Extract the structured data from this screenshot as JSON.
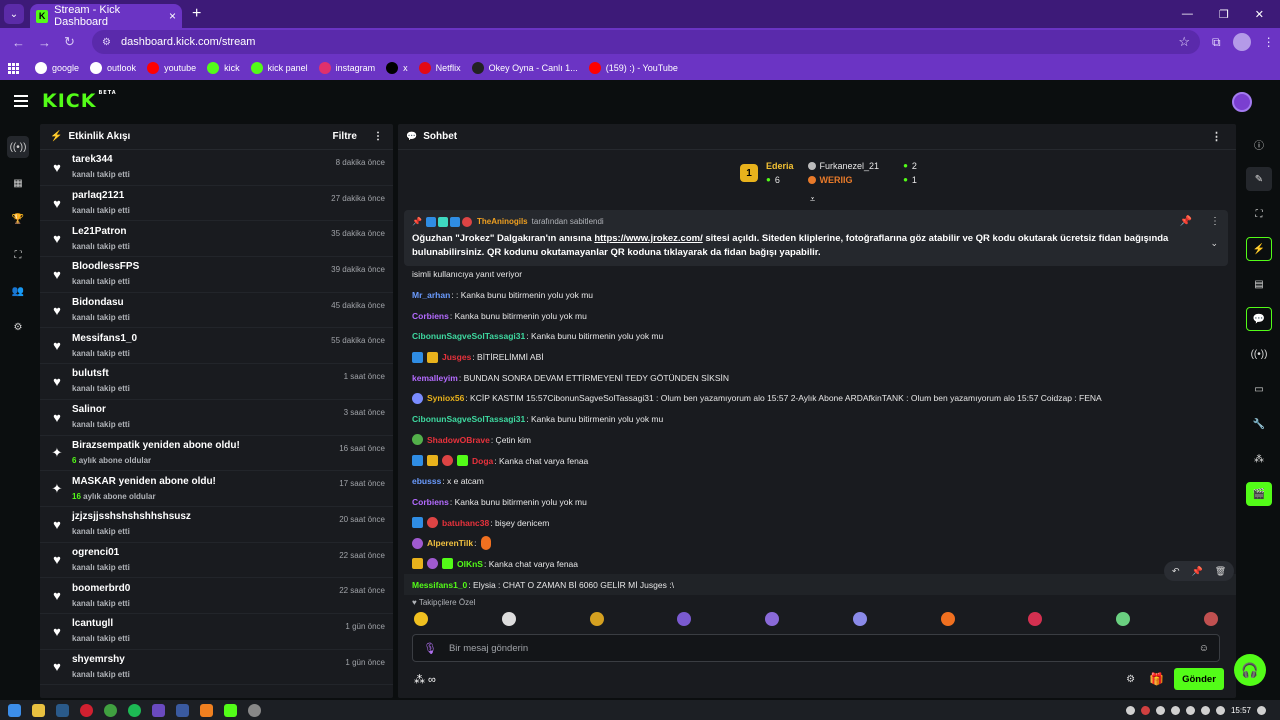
{
  "browser": {
    "tab_title": "Stream - Kick Dashboard",
    "tab_close": "×",
    "new_tab": "+",
    "url": "dashboard.kick.com/stream",
    "bookmarks": [
      {
        "label": "google",
        "color": "#ffffff"
      },
      {
        "label": "outlook",
        "color": "#ffffff"
      },
      {
        "label": "youtube",
        "color": "#ff0000"
      },
      {
        "label": "kick",
        "color": "#53fc18"
      },
      {
        "label": "kick panel",
        "color": "#53fc18"
      },
      {
        "label": "instagram",
        "color": "#e1306c"
      },
      {
        "label": "x",
        "color": "#000000"
      },
      {
        "label": "Netflix",
        "color": "#e50914"
      },
      {
        "label": "Okey Oyna - Canlı 1...",
        "color": "#222222"
      },
      {
        "label": "(159) :) - YouTube",
        "color": "#ff0000"
      }
    ]
  },
  "app": {
    "logo": "KICK",
    "beta": "BETA",
    "accent": "#53fc18"
  },
  "feed": {
    "title": "Etkinlik Akışı",
    "filter_label": "Filtre",
    "items": [
      {
        "name": "tarek344",
        "sub": "kanalı takip etti",
        "time": "8 dakika önce",
        "icon": "heart-icon"
      },
      {
        "name": "parlaq2121",
        "sub": "kanalı takip etti",
        "time": "27 dakika önce",
        "icon": "heart-icon"
      },
      {
        "name": "Le21Patron",
        "sub": "kanalı takip etti",
        "time": "35 dakika önce",
        "icon": "heart-icon"
      },
      {
        "name": "BloodlessFPS",
        "sub": "kanalı takip etti",
        "time": "39 dakika önce",
        "icon": "heart-icon"
      },
      {
        "name": "Bidondasu",
        "sub": "kanalı takip etti",
        "time": "45 dakika önce",
        "icon": "heart-icon"
      },
      {
        "name": "Messifans1_0",
        "sub": "kanalı takip etti",
        "time": "55 dakika önce",
        "icon": "heart-icon"
      },
      {
        "name": "bulutsft",
        "sub": "kanalı takip etti",
        "time": "1 saat önce",
        "icon": "heart-icon"
      },
      {
        "name": "Salinor",
        "sub": "kanalı takip etti",
        "time": "3 saat önce",
        "icon": "heart-icon"
      },
      {
        "name": "Birazsempatik yeniden abone oldu!",
        "sub_num": "6",
        "sub": "aylık abone oldular",
        "time": "16 saat önce",
        "icon": "sparkle-icon"
      },
      {
        "name": "MASKAR yeniden abone oldu!",
        "sub_num": "16",
        "sub": "aylık abone oldular",
        "time": "17 saat önce",
        "icon": "sparkle-icon"
      },
      {
        "name": "jzjzsjjsshshshshhshsusz",
        "sub": "kanalı takip etti",
        "time": "20 saat önce",
        "icon": "heart-icon"
      },
      {
        "name": "ogrenci01",
        "sub": "kanalı takip etti",
        "time": "22 saat önce",
        "icon": "heart-icon"
      },
      {
        "name": "boomerbrd0",
        "sub": "kanalı takip etti",
        "time": "22 saat önce",
        "icon": "heart-icon"
      },
      {
        "name": "lcantugll",
        "sub": "kanalı takip etti",
        "time": "1 gün önce",
        "icon": "heart-icon"
      },
      {
        "name": "shyemrshy",
        "sub": "kanalı takip etti",
        "time": "1 gün önce",
        "icon": "heart-icon"
      }
    ]
  },
  "chat": {
    "title": "Sohbet",
    "leaderboard": {
      "rank": "1",
      "first_name": "Ederia",
      "first_count": "6",
      "second_name": "Furkanezel_21",
      "second_count": "2",
      "third_name": "WERIIG",
      "third_count": "1"
    },
    "pinned": {
      "user": "TheAninogils",
      "pinned_by": "tarafından sabitlendi",
      "message_pre": "Oğuzhan \"Jrokez\" Dalgakıran'ın anısına ",
      "link": "https://www.jrokez.com/",
      "message_post": " sitesi açıldı. Siteden kliplerine, fotoğraflarına göz atabilir ve QR kodu okutarak ücretsiz fidan bağışında bulunabilirsiniz. QR kodunu okutamayanlar QR koduna tıklayarak da fidan bağışı yapabilir."
    },
    "messages": [
      {
        "user": "",
        "color": "#e8e8e8",
        "text": "isimli kullanıcıya yanıt veriyor",
        "badges": []
      },
      {
        "user": "Mr_arhan",
        "color": "#6b9cff",
        "text": ": : Kanka bunu bitirmenin yolu yok mu",
        "badges": []
      },
      {
        "user": "Corbiens",
        "color": "#b46bff",
        "text": ": Kanka bunu bitirmenin yolu yok mu",
        "badges": []
      },
      {
        "user": "CibonunSagveSolTassagi31",
        "color": "#3ed9a0",
        "text": ": Kanka bunu bitirmenin yolu yok mu",
        "badges": []
      },
      {
        "user": "Jusges",
        "color": "#e8323c",
        "text": ": BİTİRELİMMİ ABİ",
        "badges": [
          "#2f8de4",
          "#e8b21c"
        ]
      },
      {
        "user": "kemalleyim",
        "color": "#b46bff",
        "text": ": BUNDAN SONRA DEVAM ETTİRMEYENİ TEDY GÖTÜNDEN SİKSİN",
        "badges": []
      },
      {
        "user": "Syniox56",
        "color": "#e8b21c",
        "text": ": KCİP KASTIM 15:57CibonunSagveSolTassagi31 : Olum ben yazamıyorum alo 15:57 2-Aylık Abone ARDAfkinTANK : Olum ben yazamıyorum alo 15:57 Coidzap : FENA",
        "badges": [
          "#7a8cff"
        ]
      },
      {
        "user": "CibonunSagveSolTassagi31",
        "color": "#3ed9a0",
        "text": ": Kanka bunu bitirmenin yolu yok mu",
        "badges": []
      },
      {
        "user": "ShadowOBrave",
        "color": "#e8323c",
        "text": ": Çetin kim",
        "badges": [
          "#53b04a"
        ]
      },
      {
        "user": "Doga",
        "color": "#e8323c",
        "text": ": Kanka chat varya fenaa",
        "badges": [
          "#2f8de4",
          "#e8b21c",
          "#d44",
          "#53fc18"
        ]
      },
      {
        "user": "ebusss",
        "color": "#6b9cff",
        "text": ": x e atcam",
        "badges": []
      },
      {
        "user": "Corbiens",
        "color": "#b46bff",
        "text": ": Kanka bunu bitirmenin yolu yok mu",
        "badges": []
      },
      {
        "user": "batuhanc38",
        "color": "#e8323c",
        "text": ": bişey denicem",
        "badges": [
          "#2f8de4",
          "#d44"
        ]
      },
      {
        "user": "AlperenTilk",
        "color": "#f0c040",
        "text": ": ",
        "badges": [
          "#a05ad0"
        ]
      },
      {
        "user": "OlKnS",
        "color": "#53fc18",
        "text": ": Kanka chat varya fenaa",
        "badges": [
          "#e8b21c",
          "#a05ad0",
          "#53fc18"
        ]
      },
      {
        "user": "Messifans1_0",
        "color": "#53fc18",
        "text": ": Elysia : CHAT O ZAMAN Bİ 6060 GELİR Mİ Jusges :\\",
        "badges": []
      }
    ],
    "emote_section": "Takipçilere Özel",
    "input_placeholder": "Bir mesaj gönderin",
    "send_label": "Gönder"
  },
  "system": {
    "clock": "15:57"
  }
}
